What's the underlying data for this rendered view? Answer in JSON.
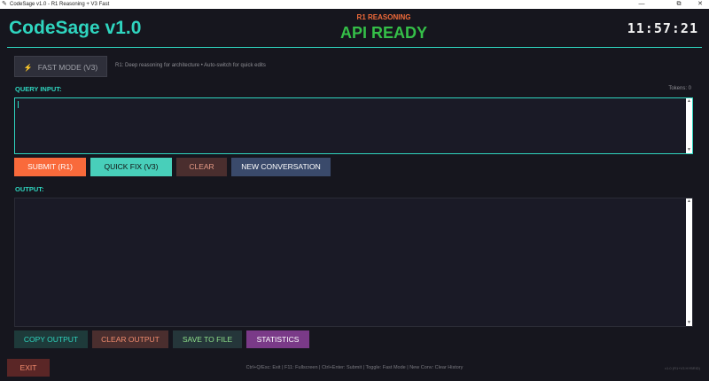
{
  "window": {
    "title": "CodeSage v1.0 - R1 Reasoning + V3 Fast",
    "minimize": "—",
    "restore": "⧉",
    "close": "✕"
  },
  "header": {
    "logo": "CodeSage v1.0",
    "mode_label": "R1 REASONING",
    "status": "API READY",
    "clock": "11:57:21"
  },
  "mode": {
    "button_label": "FAST MODE (V3)",
    "button_icon": "lightning-bolt-icon",
    "description": "R1: Deep reasoning for architecture • Auto-switch for quick edits"
  },
  "query": {
    "label": "QUERY INPUT:",
    "tokens": "Tokens: 0",
    "value": ""
  },
  "query_actions": {
    "submit": "SUBMIT (R1)",
    "quick_fix": "QUICK FIX (V3)",
    "clear": "CLEAR",
    "new_conversation": "NEW CONVERSATION"
  },
  "output": {
    "label": "OUTPUT:",
    "value": ""
  },
  "output_actions": {
    "copy": "COPY OUTPUT",
    "clear": "CLEAR OUTPUT",
    "save": "SAVE TO FILE",
    "statistics": "STATISTICS"
  },
  "footer": {
    "exit": "EXIT",
    "shortcuts": "Ctrl+Q/Esc: Exit | F11: Fullscreen | Ctrl+Enter: Submit | Toggle: Fast Mode | New Conv: Clear History",
    "version": "v1.0 (R1+V3 HYBRID)"
  },
  "colors": {
    "background": "#16161e",
    "accent_teal": "#2fd5bf",
    "submit_orange": "#f96a3b",
    "status_green": "#35bf48",
    "statistics_purple": "#7a3a88"
  }
}
